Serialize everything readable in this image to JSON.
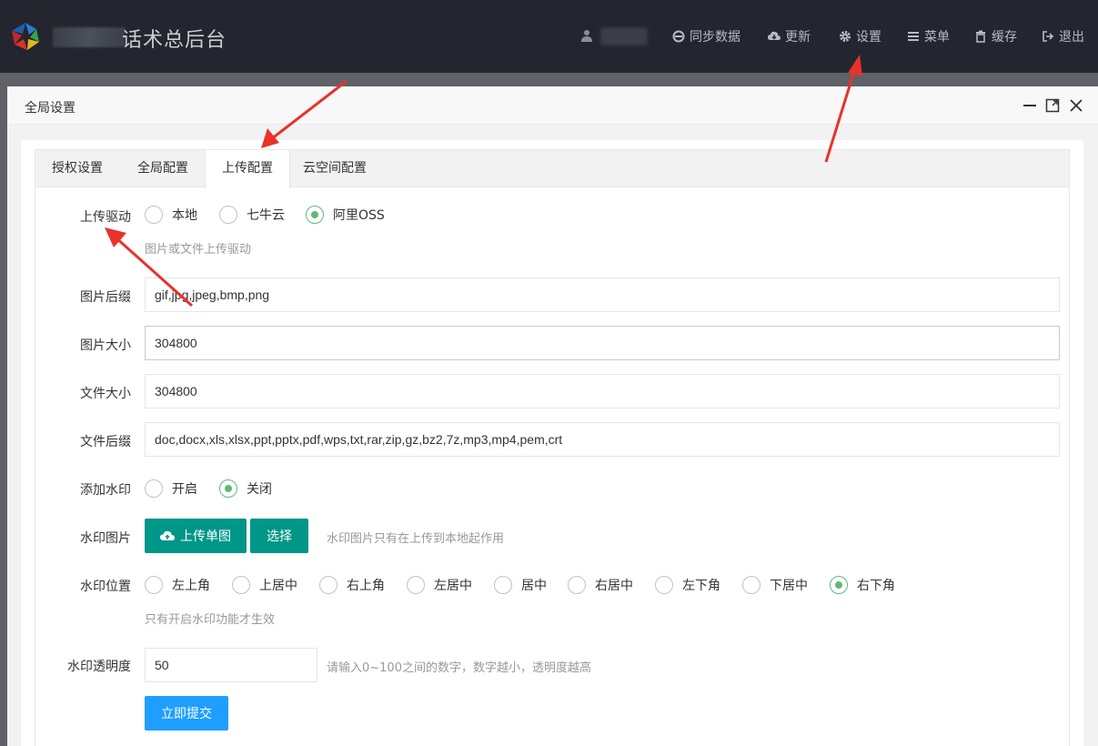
{
  "header": {
    "title": "话术总后台",
    "nav": [
      {
        "label": "同步数据",
        "icon": "ie-icon"
      },
      {
        "label": "更新",
        "icon": "cloud-download-icon"
      },
      {
        "label": "设置",
        "icon": "gear-icon"
      },
      {
        "label": "菜单",
        "icon": "menu-icon"
      },
      {
        "label": "缓存",
        "icon": "trash-icon"
      },
      {
        "label": "退出",
        "icon": "sign-out-icon"
      }
    ]
  },
  "modal": {
    "title": "全局设置",
    "tabs": [
      "授权设置",
      "全局配置",
      "上传配置",
      "云空间配置"
    ],
    "active_tab": "上传配置"
  },
  "form": {
    "upload_driver": {
      "label": "上传驱动",
      "options": [
        "本地",
        "七牛云",
        "阿里OSS"
      ],
      "selected": "阿里OSS",
      "hint": "图片或文件上传驱动"
    },
    "image_ext": {
      "label": "图片后缀",
      "value": "gif,jpg,jpeg,bmp,png"
    },
    "image_size": {
      "label": "图片大小",
      "value": "304800"
    },
    "file_size": {
      "label": "文件大小",
      "value": "304800"
    },
    "file_ext": {
      "label": "文件后缀",
      "value": "doc,docx,xls,xlsx,ppt,pptx,pdf,wps,txt,rar,zip,gz,bz2,7z,mp3,mp4,pem,crt"
    },
    "watermark": {
      "label": "添加水印",
      "options": [
        "开启",
        "关闭"
      ],
      "selected": "关闭"
    },
    "watermark_image": {
      "label": "水印图片",
      "upload_label": "上传单图",
      "select_label": "选择",
      "hint": "水印图片只有在上传到本地起作用"
    },
    "watermark_position": {
      "label": "水印位置",
      "options": [
        "左上角",
        "上居中",
        "右上角",
        "左居中",
        "居中",
        "右居中",
        "左下角",
        "下居中",
        "右下角"
      ],
      "selected": "右下角",
      "hint": "只有开启水印功能才生效"
    },
    "watermark_opacity": {
      "label": "水印透明度",
      "value": "50",
      "hint": "请输入0~100之间的数字，数字越小，透明度越高"
    },
    "submit_label": "立即提交"
  },
  "colors": {
    "topbar": "#23262e",
    "radio_checked": "#5fb878",
    "btn_green": "#009688",
    "btn_blue": "#1e9fff",
    "annotation_arrow": "#e8322a"
  }
}
